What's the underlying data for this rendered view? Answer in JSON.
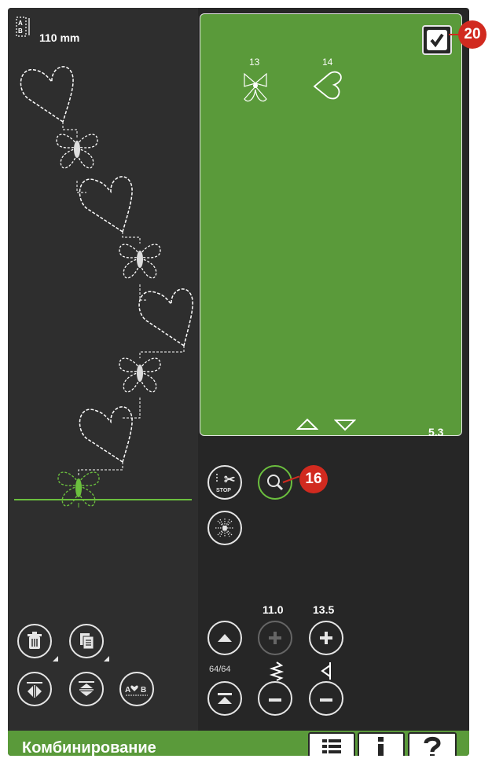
{
  "header": {
    "pattern_length": "110 mm"
  },
  "menu": {
    "stitch_numbers": [
      "13",
      "14"
    ],
    "page_number": "5.3"
  },
  "settings": {
    "stitch_width": "11.0",
    "stitch_length": "13.5",
    "stitch_position": "64/64"
  },
  "footer": {
    "title": "Комбинирование"
  },
  "callouts": {
    "confirm": "20",
    "zoom": "16"
  },
  "colors": {
    "screen": "#262626",
    "panel": "#5a9a3a",
    "accent": "#6bbf3e",
    "callout": "#d12a1f"
  }
}
